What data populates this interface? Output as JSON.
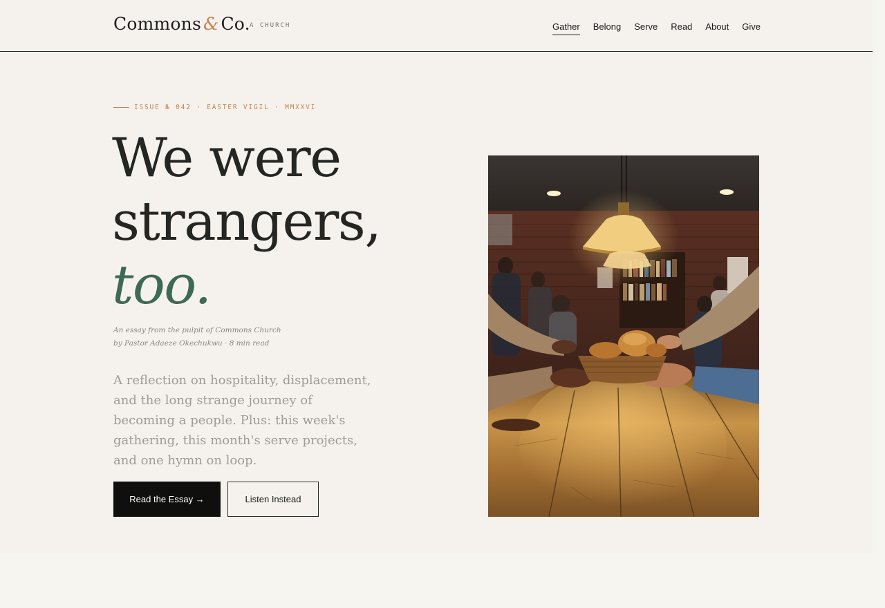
{
  "brand": {
    "name_part1": "Commons",
    "ampersand": "&",
    "name_part2": "Co.",
    "tag": "A CHURCH"
  },
  "nav": {
    "items": [
      {
        "label": "Gather",
        "active": true
      },
      {
        "label": "Belong",
        "active": false
      },
      {
        "label": "Serve",
        "active": false
      },
      {
        "label": "Read",
        "active": false
      },
      {
        "label": "About",
        "active": false
      },
      {
        "label": "Give",
        "active": false
      }
    ]
  },
  "hero": {
    "kicker": "ISSUE № 042 · EASTER VIGIL · MMXXVI",
    "headline_line1": "We were",
    "headline_line2": "strangers,",
    "headline_accent": "too.",
    "byline_line1": "An essay from the pulpit of Commons Church",
    "byline_line2": "by Pastor Adaeze Okechukwu · 8 min read",
    "lede": "A reflection on hospitality, displacement, and the long strange journey of becoming a people. Plus: this week's gathering, this month's serve projects, and one hymn on loop.",
    "primary_button": "Read the Essay →",
    "secondary_button": "Listen Instead"
  },
  "colors": {
    "accent_copper": "#c3834f",
    "accent_green": "#3e6a53",
    "ink": "#1d1d1b",
    "paper": "#f5f2ed"
  }
}
